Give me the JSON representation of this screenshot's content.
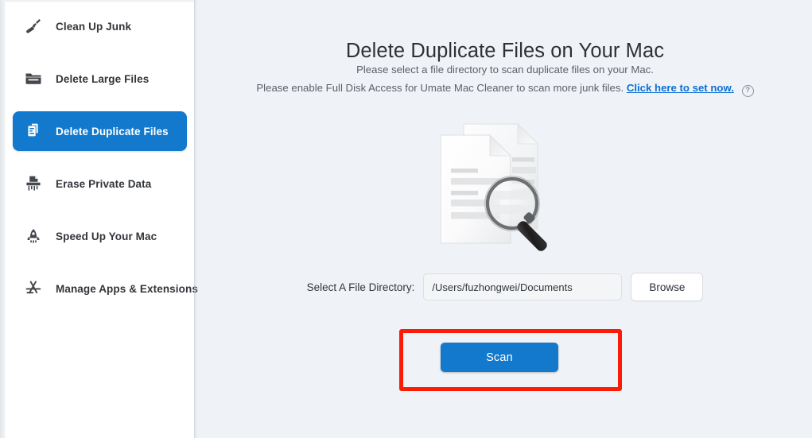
{
  "sidebar": {
    "items": [
      {
        "label": "Clean Up Junk",
        "icon": "broom-icon",
        "active": false
      },
      {
        "label": "Delete Large Files",
        "icon": "folder-icon",
        "active": false
      },
      {
        "label": "Delete Duplicate Files",
        "icon": "duplicate-files-icon",
        "active": true
      },
      {
        "label": "Erase Private Data",
        "icon": "shredder-icon",
        "active": false
      },
      {
        "label": "Speed Up Your Mac",
        "icon": "rocket-icon",
        "active": false
      },
      {
        "label": "Manage Apps & Extensions",
        "icon": "app-store-icon",
        "active": false
      }
    ]
  },
  "main": {
    "title": "Delete Duplicate Files on Your Mac",
    "subtitle_1": "Please select a file directory to scan duplicate files on your Mac.",
    "subtitle_2_prefix": "Please enable Full Disk Access for Umate Mac Cleaner to scan more junk files.",
    "subtitle_2_link": "Click here to set now.",
    "help_icon_glyph": "?",
    "illustration_name": "duplicate-documents-magnifier-illustration",
    "directory": {
      "label": "Select A File Directory:",
      "value": "/Users/fuzhongwei/Documents",
      "placeholder": "/Users/fuzhongwei/Documents",
      "browse_label": "Browse"
    },
    "scan_label": "Scan"
  },
  "colors": {
    "accent_blue": "#1279cd",
    "link_blue": "#0c6fd4",
    "highlight_red": "#fa1c06",
    "panel_bg": "#eff2f6",
    "sidebar_bg": "#ffffff"
  }
}
